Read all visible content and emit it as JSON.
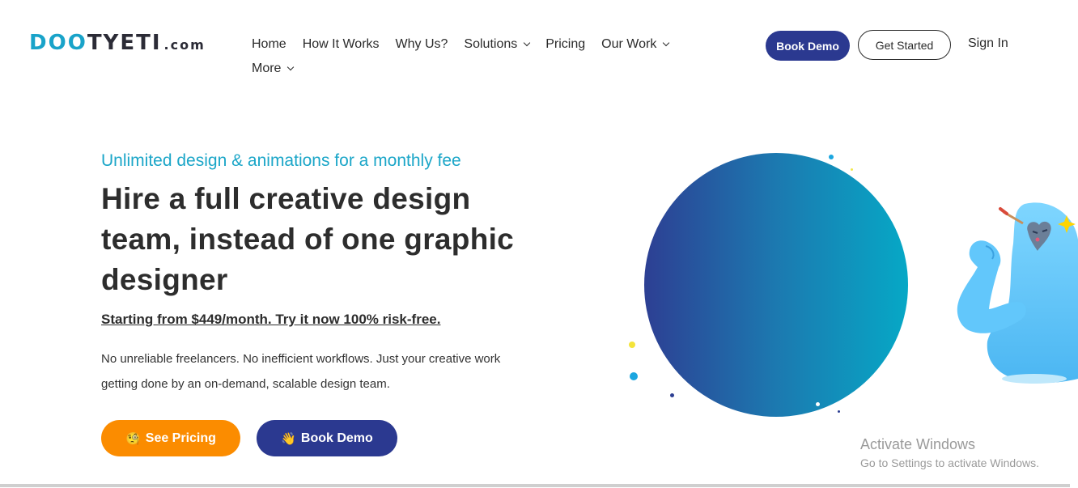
{
  "brand": {
    "logo_prefix": "D",
    "logo_oo": "OO",
    "logo_rest": "TYETI",
    "logo_suffix": ".com",
    "accent_color": "#19a3c9",
    "primary_color": "#2b3990",
    "orange_color": "#fb8c00"
  },
  "nav": {
    "row1": [
      {
        "label": "Home",
        "has_dropdown": false
      },
      {
        "label": "How It Works",
        "has_dropdown": false
      },
      {
        "label": "Why Us?",
        "has_dropdown": false
      },
      {
        "label": "Solutions",
        "has_dropdown": true
      },
      {
        "label": "Pricing",
        "has_dropdown": false
      },
      {
        "label": "Our Work",
        "has_dropdown": true
      }
    ],
    "row2": [
      {
        "label": "More",
        "has_dropdown": true
      }
    ]
  },
  "header_actions": {
    "book_demo": "Book Demo",
    "get_started": "Get Started",
    "sign_in": "Sign In"
  },
  "hero": {
    "eyebrow": "Unlimited design & animations for a monthly fee",
    "headline": "Hire a full creative design team, instead of one graphic designer",
    "price_link": "Starting from $449/month. Try it now 100% risk-free.",
    "description": "No unreliable freelancers. No inefficient workflows. Just your creative work getting done by an on-demand, scalable design team.",
    "see_pricing": "See Pricing",
    "see_pricing_emoji": "🧐",
    "book_demo": "Book Demo",
    "book_demo_emoji": "👋"
  },
  "illustration": {
    "mascot_icon": "yeti-mascot-icon"
  },
  "watermark": {
    "title": "Activate Windows",
    "subtitle": "Go to Settings to activate Windows."
  }
}
